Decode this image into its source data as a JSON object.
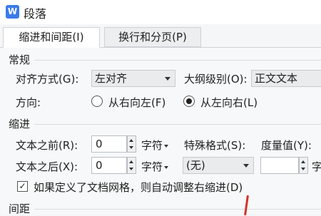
{
  "window": {
    "title": "段落",
    "icon_letter": "W"
  },
  "tabs": [
    {
      "label": "缩进和间距(I)"
    },
    {
      "label": "换行和分页(P)"
    }
  ],
  "general": {
    "heading": "常规",
    "alignment_label": "对齐方式(G):",
    "alignment_value": "左对齐",
    "outline_label": "大纲级别(O):",
    "outline_value": "正文文本",
    "direction_label": "方向:",
    "rtl_label": "从右向左(F)",
    "ltr_label": "从左向右(L)"
  },
  "indent": {
    "heading": "缩进",
    "before_label": "文本之前(R):",
    "before_value": "0",
    "before_unit": "字符",
    "after_label": "文本之后(X):",
    "after_value": "0",
    "after_unit": "字符",
    "special_label": "特殊格式(S):",
    "special_value": "(无)",
    "measure_label": "度量值(Y):",
    "measure_value": "",
    "measure_unit": "字",
    "auto_adjust_label": "如果定义了文档网格，则自动调整右缩进(D)",
    "auto_adjust_checked": true
  },
  "spacing": {
    "heading": "间距"
  },
  "colors": {
    "accent": "#3a7be8",
    "annotation": "#d3322b"
  }
}
